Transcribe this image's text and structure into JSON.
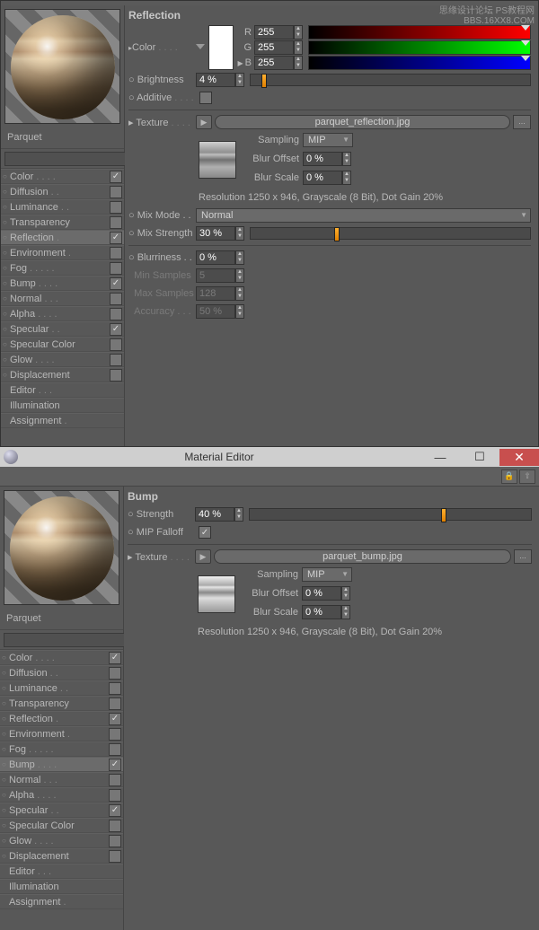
{
  "watermark": {
    "line1": "思缘设计论坛 PS教程网",
    "line2": "BBS.16XX8.COM"
  },
  "material_name": "Parquet",
  "channels": [
    {
      "label": "Color",
      "checked": true,
      "selected": false
    },
    {
      "label": "Diffusion",
      "checked": false,
      "selected": false
    },
    {
      "label": "Luminance",
      "checked": false,
      "selected": false
    },
    {
      "label": "Transparency",
      "checked": false,
      "selected": false
    },
    {
      "label": "Reflection",
      "checked": true,
      "selected": true
    },
    {
      "label": "Environment",
      "checked": false,
      "selected": false
    },
    {
      "label": "Fog",
      "checked": false,
      "selected": false
    },
    {
      "label": "Bump",
      "checked": true,
      "selected": false
    },
    {
      "label": "Normal",
      "checked": false,
      "selected": false
    },
    {
      "label": "Alpha",
      "checked": false,
      "selected": false
    },
    {
      "label": "Specular",
      "checked": true,
      "selected": false
    },
    {
      "label": "Specular Color",
      "checked": false,
      "selected": false
    },
    {
      "label": "Glow",
      "checked": false,
      "selected": false
    },
    {
      "label": "Displacement",
      "checked": false,
      "selected": false
    },
    {
      "label": "Editor",
      "checked": null,
      "selected": false
    },
    {
      "label": "Illumination",
      "checked": null,
      "selected": false
    },
    {
      "label": "Assignment",
      "checked": null,
      "selected": false
    }
  ],
  "reflection": {
    "title": "Reflection",
    "color_label": "Color",
    "rgb_labels": {
      "r": "R",
      "g": "G",
      "b": "B"
    },
    "r": "255",
    "g": "255",
    "b": "255",
    "brightness_label": "Brightness",
    "brightness": "4 %",
    "brightness_pct": 4,
    "additive_label": "Additive",
    "additive": false,
    "texture_label": "Texture",
    "texture_file": "parquet_reflection.jpg",
    "sampling_label": "Sampling",
    "sampling": "MIP",
    "blur_offset_label": "Blur Offset",
    "blur_offset": "0 %",
    "blur_scale_label": "Blur Scale",
    "blur_scale": "0 %",
    "resolution": "Resolution 1250 x 946, Grayscale (8 Bit), Dot Gain 20%",
    "mix_mode_label": "Mix Mode",
    "mix_mode": "Normal",
    "mix_strength_label": "Mix Strength",
    "mix_strength": "30 %",
    "mix_strength_pct": 30,
    "blurriness_label": "Blurriness",
    "blurriness": "0 %",
    "min_samples_label": "Min Samples",
    "min_samples": "5",
    "max_samples_label": "Max Samples",
    "max_samples": "128",
    "accuracy_label": "Accuracy",
    "accuracy": "50 %"
  },
  "editor_title": "Material Editor",
  "channels2_selected": "Bump",
  "bump": {
    "title": "Bump",
    "strength_label": "Strength",
    "strength": "40 %",
    "strength_pct": 40,
    "mip_falloff_label": "MIP Falloff",
    "mip_falloff": true,
    "texture_label": "Texture",
    "texture_file": "parquet_bump.jpg",
    "sampling_label": "Sampling",
    "sampling": "MIP",
    "blur_offset_label": "Blur Offset",
    "blur_offset": "0 %",
    "blur_scale_label": "Blur Scale",
    "blur_scale": "0 %",
    "resolution": "Resolution 1250 x 946, Grayscale (8 Bit), Dot Gain 20%"
  }
}
